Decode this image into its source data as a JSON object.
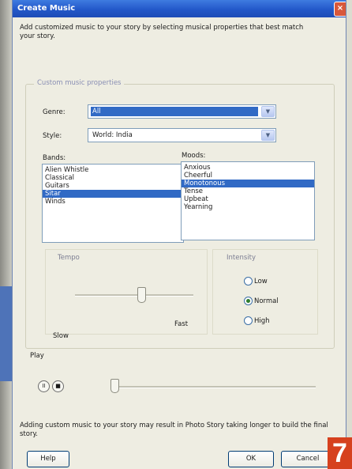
{
  "window": {
    "title": "Create Music",
    "intro": "Add customized music to your story by selecting musical properties that best match your story."
  },
  "properties": {
    "group_title": "Custom music properties",
    "genre_label": "Genre:",
    "genre_value": "All",
    "style_label": "Style:",
    "style_value": "World: India",
    "bands_label": "Bands:",
    "bands": [
      "Alien Whistle",
      "Classical",
      "Guitars",
      "Sitar",
      "Winds"
    ],
    "bands_selected": "Sitar",
    "moods_label": "Moods:",
    "moods": [
      "Anxious",
      "Cheerful",
      "Monotonous",
      "Tense",
      "Upbeat",
      "Yearning"
    ],
    "moods_selected": "Monotonous",
    "tempo_label": "Tempo",
    "tempo_slow": "Slow",
    "tempo_fast": "Fast",
    "tempo_level": 0.55,
    "intensity_label": "Intensity",
    "intensity_options": [
      "Low",
      "Normal",
      "High"
    ],
    "intensity_selected": "Normal"
  },
  "play": {
    "label": "Play",
    "pause_symbol": "II",
    "stop_symbol": "■",
    "position": 0.0
  },
  "footer": {
    "note": "Adding custom music to your story may result in Photo Story taking longer to build the final story.",
    "help": "Help",
    "ok": "OK",
    "cancel": "Cancel"
  },
  "overlay_badge": "7",
  "colors": {
    "titlebar": "#2358c9",
    "selection": "#316ac5",
    "badge": "#d6411e"
  }
}
